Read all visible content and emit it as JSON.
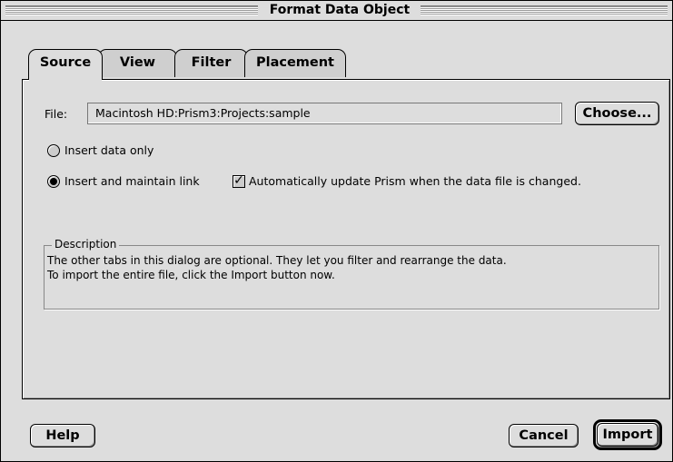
{
  "window": {
    "title": "Format Data Object"
  },
  "tabs": [
    {
      "label": "Source",
      "active": true
    },
    {
      "label": "View",
      "active": false
    },
    {
      "label": "Filter",
      "active": false
    },
    {
      "label": "Placement",
      "active": false
    }
  ],
  "source": {
    "file_label": "File:",
    "file_path": "Macintosh HD:Prism3:Projects:sample",
    "choose_label": "Choose...",
    "radio_insert_only": {
      "label": "Insert data only",
      "checked": false
    },
    "radio_insert_link": {
      "label": "Insert and maintain link",
      "checked": true
    },
    "auto_update": {
      "label": "Automatically update Prism when the data file is changed.",
      "checked": true
    }
  },
  "description": {
    "title": "Description",
    "line1": "The other tabs in this dialog are optional. They let you filter and rearrange the data.",
    "line2": "To import the entire file, click the Import button now."
  },
  "buttons": {
    "help": "Help",
    "cancel": "Cancel",
    "import": "Import"
  },
  "colors": {
    "window_bg": "#dddddd",
    "border": "#000000"
  }
}
